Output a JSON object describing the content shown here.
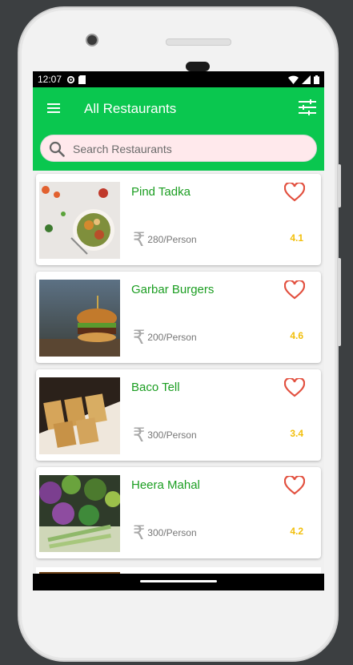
{
  "status_bar": {
    "time": "12:07"
  },
  "app_bar": {
    "title": "All Restaurants"
  },
  "search": {
    "placeholder": "Search Restaurants"
  },
  "colors": {
    "accent": "#0ac74f",
    "name_text": "#1c9e22",
    "rating": "#f2bf0c",
    "heart": "#e2503f"
  },
  "currency_symbol": "₹",
  "restaurants": [
    {
      "name": "Pind Tadka",
      "price": "280/Person",
      "rating": "4.1"
    },
    {
      "name": "Garbar Burgers",
      "price": "200/Person",
      "rating": "4.6"
    },
    {
      "name": "Baco Tell",
      "price": "300/Person",
      "rating": "3.4"
    },
    {
      "name": "Heera Mahal",
      "price": "300/Person",
      "rating": "4.2"
    }
  ]
}
